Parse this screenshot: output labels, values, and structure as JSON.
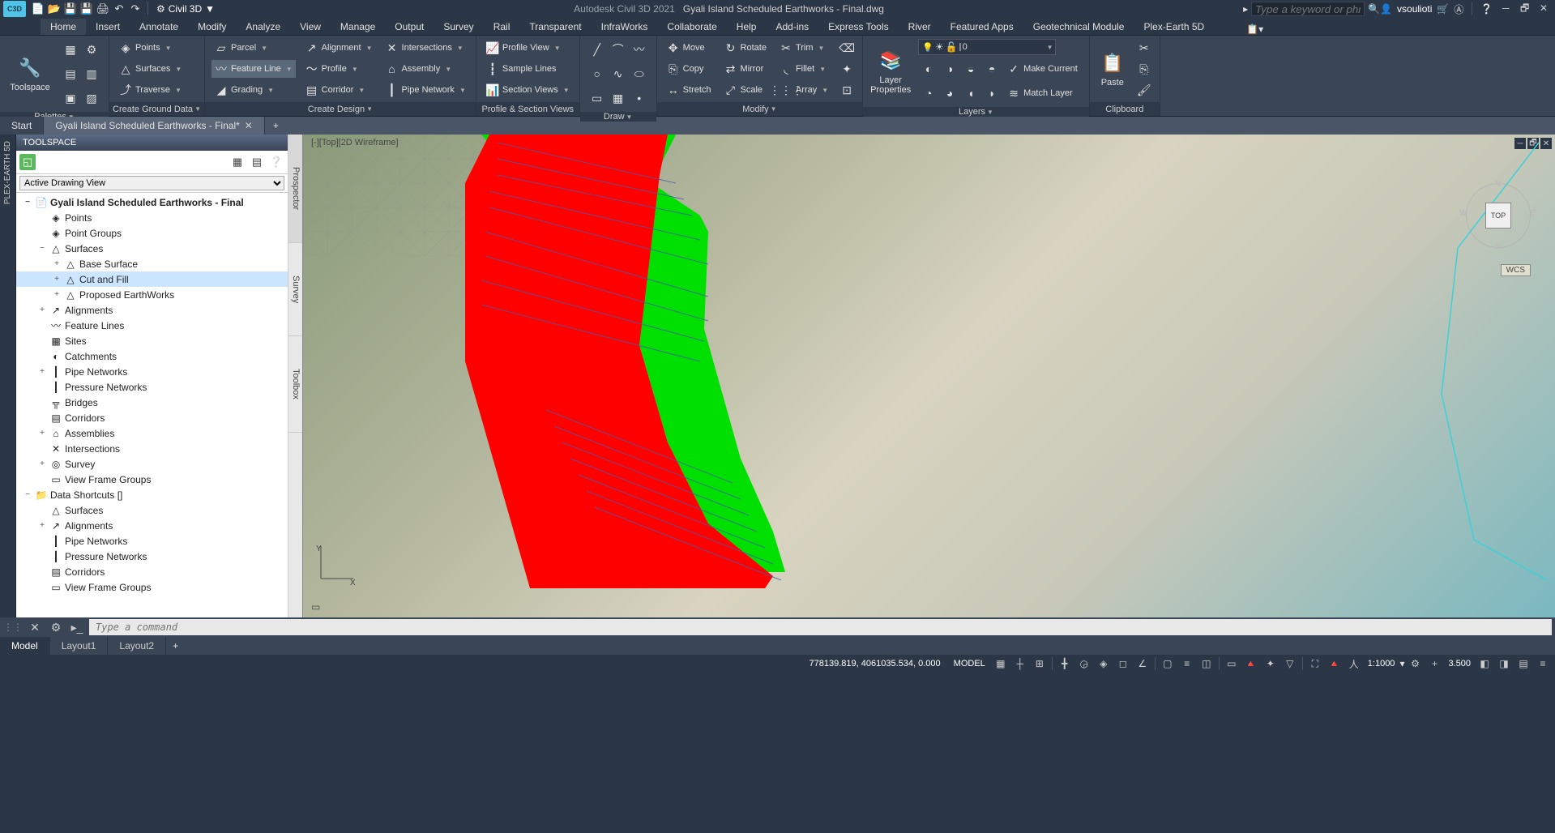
{
  "app": {
    "logo_text": "C3D",
    "workspace": "Civil 3D",
    "title_prefix": "Autodesk Civil 3D 2021",
    "doc_name": "Gyali Island Scheduled Earthworks - Final.dwg",
    "search_placeholder": "Type a keyword or phrase",
    "user": "vsoulioti"
  },
  "ribbon_tabs": [
    "Home",
    "Insert",
    "Annotate",
    "Modify",
    "Analyze",
    "View",
    "Manage",
    "Output",
    "Survey",
    "Rail",
    "Transparent",
    "InfraWorks",
    "Collaborate",
    "Help",
    "Add-ins",
    "Express Tools",
    "River",
    "Featured Apps",
    "Geotechnical Module",
    "Plex-Earth 5D"
  ],
  "ribbon": {
    "toolspace": "Toolspace",
    "palettes": "Palettes",
    "ground": {
      "points": "Points",
      "surfaces": "Surfaces",
      "traverse": "Traverse",
      "title": "Create Ground Data"
    },
    "design": {
      "parcel": "Parcel",
      "feature": "Feature Line",
      "grading": "Grading",
      "alignment": "Alignment",
      "profile": "Profile",
      "corridor": "Corridor",
      "intersections": "Intersections",
      "assembly": "Assembly",
      "pipe": "Pipe Network",
      "title": "Create Design"
    },
    "profile_panel": {
      "pview": "Profile View",
      "samp": "Sample Lines",
      "sviews": "Section Views",
      "title": "Profile & Section Views"
    },
    "draw": {
      "title": "Draw"
    },
    "modify": {
      "move": "Move",
      "copy": "Copy",
      "stretch": "Stretch",
      "rotate": "Rotate",
      "mirror": "Mirror",
      "scale": "Scale",
      "trim": "Trim",
      "fillet": "Fillet",
      "array": "Array",
      "title": "Modify"
    },
    "layers": {
      "big": "Layer Properties",
      "make": "Make Current",
      "match": "Match Layer",
      "layer0": "0",
      "title": "Layers"
    },
    "clipboard": {
      "paste": "Paste",
      "title": "Clipboard"
    }
  },
  "file_tabs": {
    "start": "Start",
    "file": "Gyali Island Scheduled Earthworks - Final*"
  },
  "toolspace": {
    "title": "TOOLSPACE",
    "view": "Active Drawing View",
    "side_tabs": [
      "Prospector",
      "Survey",
      "Toolbox"
    ],
    "tree": [
      {
        "label": "Gyali Island Scheduled Earthworks - Final",
        "indent": 0,
        "expand": "−",
        "bold": true,
        "icon": "📄"
      },
      {
        "label": "Points",
        "indent": 1,
        "icon": "◈"
      },
      {
        "label": "Point Groups",
        "indent": 1,
        "icon": "◈"
      },
      {
        "label": "Surfaces",
        "indent": 1,
        "expand": "−",
        "icon": "△"
      },
      {
        "label": "Base Surface",
        "indent": 2,
        "expand": "+",
        "icon": "△"
      },
      {
        "label": "Cut and Fill",
        "indent": 2,
        "expand": "+",
        "icon": "△",
        "selected": true
      },
      {
        "label": "Proposed EarthWorks",
        "indent": 2,
        "expand": "+",
        "icon": "△"
      },
      {
        "label": "Alignments",
        "indent": 1,
        "expand": "+",
        "icon": "↗"
      },
      {
        "label": "Feature Lines",
        "indent": 1,
        "icon": "〰"
      },
      {
        "label": "Sites",
        "indent": 1,
        "icon": "▦"
      },
      {
        "label": "Catchments",
        "indent": 1,
        "icon": "◐"
      },
      {
        "label": "Pipe Networks",
        "indent": 1,
        "expand": "+",
        "icon": "┃"
      },
      {
        "label": "Pressure Networks",
        "indent": 1,
        "icon": "┃"
      },
      {
        "label": "Bridges",
        "indent": 1,
        "icon": "╦"
      },
      {
        "label": "Corridors",
        "indent": 1,
        "icon": "▤"
      },
      {
        "label": "Assemblies",
        "indent": 1,
        "expand": "+",
        "icon": "⌂"
      },
      {
        "label": "Intersections",
        "indent": 1,
        "icon": "✕"
      },
      {
        "label": "Survey",
        "indent": 1,
        "expand": "+",
        "icon": "◎"
      },
      {
        "label": "View Frame Groups",
        "indent": 1,
        "icon": "▭"
      },
      {
        "label": "Data Shortcuts []",
        "indent": 0,
        "expand": "−",
        "icon": "📁"
      },
      {
        "label": "Surfaces",
        "indent": 1,
        "icon": "△"
      },
      {
        "label": "Alignments",
        "indent": 1,
        "expand": "+",
        "icon": "↗"
      },
      {
        "label": "Pipe Networks",
        "indent": 1,
        "icon": "┃"
      },
      {
        "label": "Pressure Networks",
        "indent": 1,
        "icon": "┃"
      },
      {
        "label": "Corridors",
        "indent": 1,
        "icon": "▤"
      },
      {
        "label": "View Frame Groups",
        "indent": 1,
        "icon": "▭"
      }
    ]
  },
  "viewport": {
    "label": "[-][Top][2D Wireframe]",
    "cube": "TOP",
    "wcs": "WCS",
    "y": "Y",
    "n": "N",
    "s": "S",
    "e": "E",
    "w": "W"
  },
  "command": {
    "placeholder": "Type a command"
  },
  "bottom_tabs": [
    "Model",
    "Layout1",
    "Layout2"
  ],
  "status": {
    "coords": "778139.819, 4061035.534, 0.000",
    "model": "MODEL",
    "scale": "1:1000",
    "deg": "3.500"
  },
  "vert_tab": "PLEX-EARTH 5D"
}
